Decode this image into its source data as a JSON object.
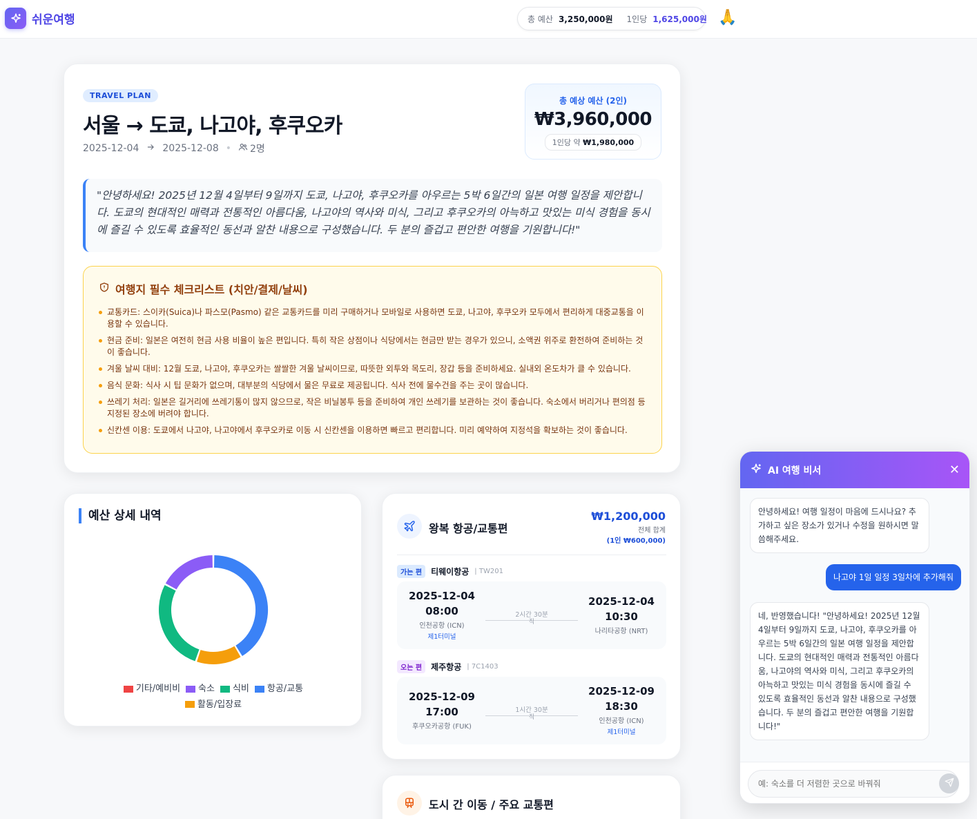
{
  "app": {
    "name": "쉬운여행"
  },
  "header": {
    "total_label": "총 예산",
    "total_value": "3,250,000원",
    "per_label": "1인당",
    "per_value": "1,625,000원",
    "profile_icon": "🙏"
  },
  "plan": {
    "tag": "TRAVEL PLAN",
    "title": "서울 → 도쿄, 나고야, 후쿠오카",
    "start_date": "2025-12-04",
    "end_date": "2025-12-08",
    "people": "2명",
    "estimate": {
      "label": "총 예상 예산 (2인)",
      "value": "₩3,960,000",
      "per_label": "1인당 약",
      "per_value": "₩1,980,000"
    },
    "quote": "\"안녕하세요! 2025년 12월 4일부터 9일까지 도쿄, 나고야, 후쿠오카를 아우르는 5박 6일간의 일본 여행 일정을 제안합니다. 도쿄의 현대적인 매력과 전통적인 아름다움, 나고야의 역사와 미식, 그리고 후쿠오카의 아늑하고 맛있는 미식 경험을 동시에 즐길 수 있도록 효율적인 동선과 알찬 내용으로 구성했습니다. 두 분의 즐겁고 편안한 여행을 기원합니다!\"",
    "checklist": {
      "title": "여행지 필수 체크리스트 (치안/결제/날씨)",
      "items": [
        "교통카드: 스이카(Suica)나 파스모(Pasmo) 같은 교통카드를 미리 구매하거나 모바일로 사용하면 도쿄, 나고야, 후쿠오카 모두에서 편리하게 대중교통을 이용할 수 있습니다.",
        "현금 준비: 일본은 여전히 현금 사용 비율이 높은 편입니다. 특히 작은 상점이나 식당에서는 현금만 받는 경우가 있으니, 소액권 위주로 환전하여 준비하는 것이 좋습니다.",
        "겨울 날씨 대비: 12월 도쿄, 나고야, 후쿠오카는 쌀쌀한 겨울 날씨이므로, 따뜻한 외투와 목도리, 장갑 등을 준비하세요. 실내외 온도차가 클 수 있습니다.",
        "음식 문화: 식사 시 팁 문화가 없으며, 대부분의 식당에서 물은 무료로 제공됩니다. 식사 전에 물수건을 주는 곳이 많습니다.",
        "쓰레기 처리: 일본은 길거리에 쓰레기통이 많지 않으므로, 작은 비닐봉투 등을 준비하여 개인 쓰레기를 보관하는 것이 좋습니다. 숙소에서 버리거나 편의점 등 지정된 장소에 버려야 합니다.",
        "신칸센 이용: 도쿄에서 나고야, 나고야에서 후쿠오카로 이동 시 신칸센을 이용하면 빠르고 편리합니다. 미리 예약하여 지정석을 확보하는 것이 좋습니다."
      ]
    }
  },
  "budget": {
    "title": "예산 상세 내역",
    "colors": {
      "etc": "#ef4444",
      "stay": "#8b5cf6",
      "food": "#10b981",
      "flight": "#3b82f6",
      "activity": "#f59e0b"
    }
  },
  "chart_data": {
    "type": "pie",
    "categories": [
      "항공/교통",
      "활동/입장료",
      "식비",
      "숙소",
      "기타/예비비"
    ],
    "values": [
      1200000,
      400000,
      800000,
      500000,
      0
    ],
    "legend": [
      "기타/예비비",
      "숙소",
      "식비",
      "항공/교통",
      "활동/입장료"
    ],
    "legend_position": "bottom"
  },
  "flights": {
    "title": "왕복 항공/교통편",
    "total": "₩1,200,000",
    "total_label": "전체 합계",
    "per_person": "(1인 ₩600,000)",
    "outbound": {
      "badge": "가는 편",
      "airline": "티웨이항공",
      "code": "| TW201",
      "dep_date": "2025-12-04",
      "dep_time": "08:00",
      "dep_airport": "인천공항 (ICN)",
      "dep_terminal": "제1터미널",
      "duration": "2시간 30분",
      "direct": "직",
      "arr_date": "2025-12-04",
      "arr_time": "10:30",
      "arr_airport": "나리타공항 (NRT)"
    },
    "inbound": {
      "badge": "오는 편",
      "airline": "제주항공",
      "code": "| 7C1403",
      "dep_date": "2025-12-09",
      "dep_time": "17:00",
      "dep_airport": "후쿠오카공항 (FUK)",
      "duration": "1시간 30분",
      "direct": "직",
      "arr_date": "2025-12-09",
      "arr_time": "18:30",
      "arr_airport": "인천공항 (ICN)",
      "arr_terminal": "제1터미널"
    }
  },
  "transit": {
    "title": "도시 간 이동 / 주요 교통편"
  },
  "chat": {
    "title": "AI 여행 비서",
    "messages": [
      {
        "role": "ai",
        "text": "안녕하세요! 여행 일정이 마음에 드시나요? 추가하고 싶은 장소가 있거나 수정을 원하시면 말씀해주세요."
      },
      {
        "role": "user",
        "text": "나고야 1일 일정 3일차에 추가해줘"
      },
      {
        "role": "ai",
        "text": "네, 반영했습니다! \"안녕하세요! 2025년 12월 4일부터 9일까지 도쿄, 나고야, 후쿠오카를 아우르는 5박 6일간의 일본 여행 일정을 제안합니다. 도쿄의 현대적인 매력과 전통적인 아름다움, 나고야의 역사와 미식, 그리고 후쿠오카의 아늑하고 맛있는 미식 경험을 동시에 즐길 수 있도록 효율적인 동선과 알찬 내용으로 구성했습니다. 두 분의 즐겁고 편안한 여행을 기원합니다!\""
      }
    ],
    "input_placeholder": "예: 숙소를 더 저렴한 곳으로 바꿔줘"
  }
}
